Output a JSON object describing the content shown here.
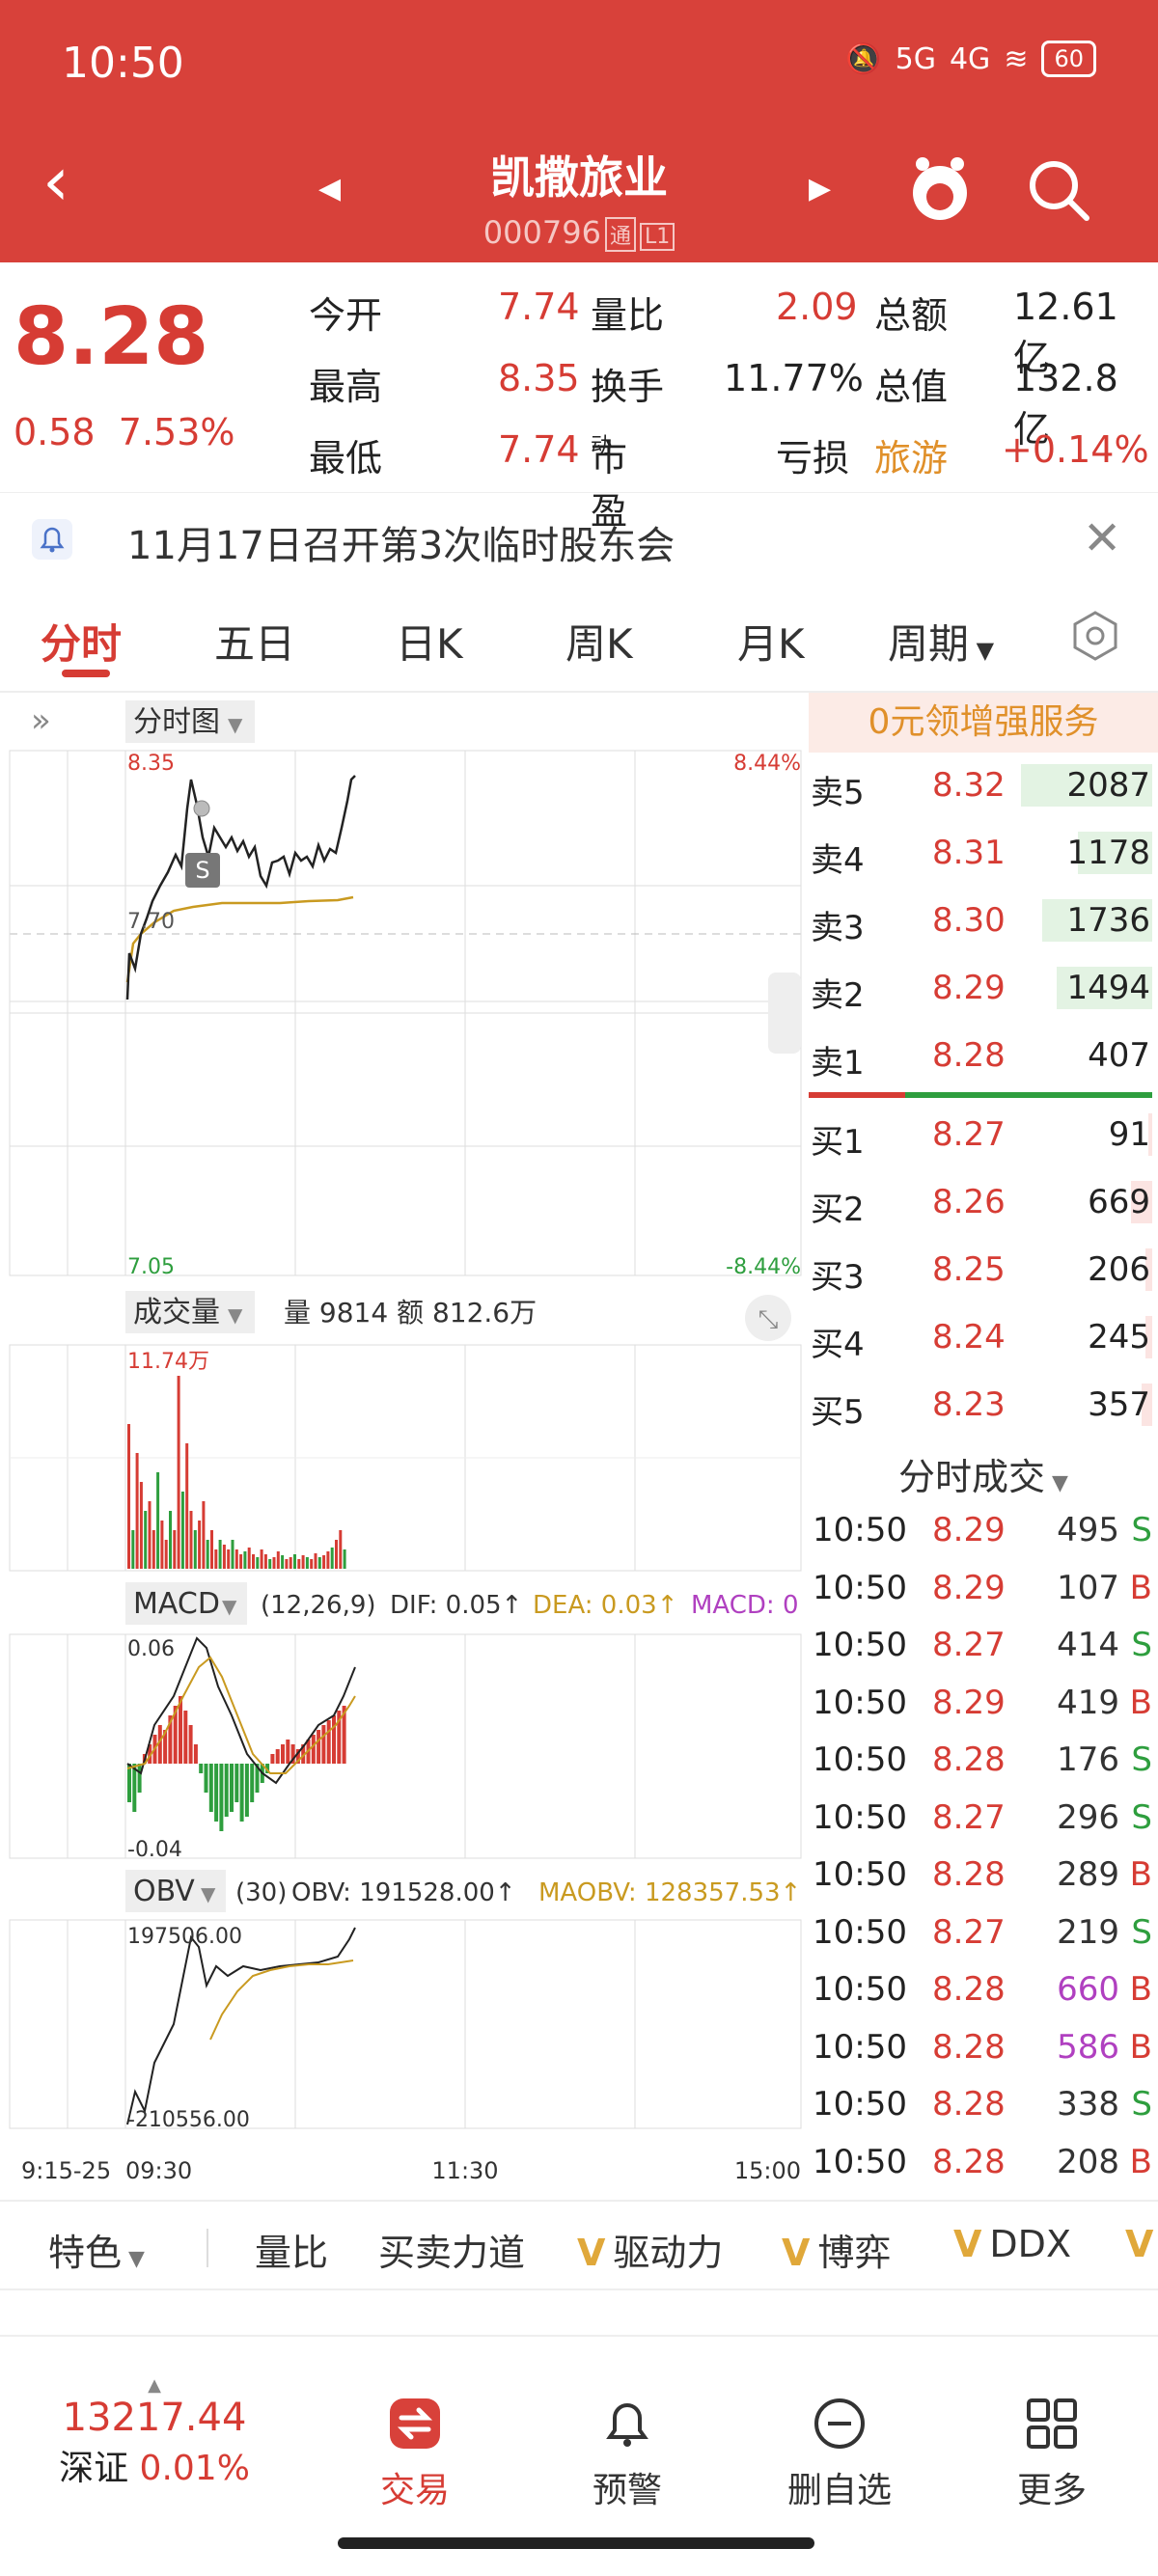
{
  "status": {
    "time": "10:50",
    "signal1": "5G",
    "signal2": "4G",
    "battery": "60"
  },
  "header": {
    "name": "凯撒旅业",
    "code": "000796",
    "tag1": "通",
    "tag2": "L1"
  },
  "quote": {
    "price": "8.28",
    "change_amt": "0.58",
    "change_pct": "7.53%",
    "rows": [
      {
        "l1": "今开",
        "v1": "7.74",
        "l2": "量比",
        "v2": "2.09",
        "l3": "总额",
        "v3": "12.61亿"
      },
      {
        "l1": "最高",
        "v1": "8.35",
        "l2": "换手",
        "v2": "11.77%",
        "l3": "总值",
        "v3": "132.8亿"
      },
      {
        "l1": "最低",
        "v1": "7.74",
        "l2": "市盈",
        "l2sup": "动",
        "v2": "亏损",
        "l3": "旅游",
        "v3": "+0.14%"
      }
    ]
  },
  "notice": {
    "text": "11月17日召开第3次临时股东会"
  },
  "tabs": [
    "分时",
    "五日",
    "日K",
    "周K",
    "月K",
    "周期"
  ],
  "chart": {
    "main_label": "分时图",
    "price_high": "8.35",
    "price_mid": "7.70",
    "price_low": "7.05",
    "pct_high": "8.44%",
    "pct_low": "-8.44%",
    "s_marker": "S",
    "volume_label": "成交量",
    "volume_info": "量 9814  额 812.6万",
    "volume_max": "11.74万",
    "macd_label": "MACD",
    "macd_params": "(12,26,9)",
    "macd_dif": "DIF: 0.05↑",
    "macd_dea": "DEA: 0.03↑",
    "macd_macd": "MACD: 0",
    "macd_high": "0.06",
    "macd_low": "-0.04",
    "obv_label": "OBV",
    "obv_params": "(30)",
    "obv_value": "OBV: 191528.00↑",
    "obv_ma": "MAOBV: 128357.53↑",
    "obv_high": "197506.00",
    "obv_low": "-210556.00",
    "time_pre": "9:15-25",
    "time_open": "09:30",
    "time_mid": "11:30",
    "time_close": "15:00"
  },
  "orderbook": {
    "title": "0元领增强服务",
    "sell": [
      {
        "label": "卖5",
        "price": "8.32",
        "vol": "2087",
        "frac": 0.62
      },
      {
        "label": "卖4",
        "price": "8.31",
        "vol": "1178",
        "frac": 0.35
      },
      {
        "label": "卖3",
        "price": "8.30",
        "vol": "1736",
        "frac": 0.52
      },
      {
        "label": "卖2",
        "price": "8.29",
        "vol": "1494",
        "frac": 0.45
      },
      {
        "label": "卖1",
        "price": "8.28",
        "vol": "407",
        "frac": 0.0
      }
    ],
    "buy": [
      {
        "label": "买1",
        "price": "8.27",
        "vol": "91",
        "frac": 0.02
      },
      {
        "label": "买2",
        "price": "8.26",
        "vol": "669",
        "frac": 0.1
      },
      {
        "label": "买3",
        "price": "8.25",
        "vol": "206",
        "frac": 0.03
      },
      {
        "label": "买4",
        "price": "8.24",
        "vol": "245",
        "frac": 0.03
      },
      {
        "label": "买5",
        "price": "8.23",
        "vol": "357",
        "frac": 0.05
      }
    ],
    "ticks_title": "分时成交",
    "ticks": [
      {
        "t": "10:50",
        "p": "8.29",
        "v": "495",
        "s": "S"
      },
      {
        "t": "10:50",
        "p": "8.29",
        "v": "107",
        "s": "B"
      },
      {
        "t": "10:50",
        "p": "8.27",
        "v": "414",
        "s": "S"
      },
      {
        "t": "10:50",
        "p": "8.29",
        "v": "419",
        "s": "B"
      },
      {
        "t": "10:50",
        "p": "8.28",
        "v": "176",
        "s": "S"
      },
      {
        "t": "10:50",
        "p": "8.27",
        "v": "296",
        "s": "S"
      },
      {
        "t": "10:50",
        "p": "8.28",
        "v": "289",
        "s": "B"
      },
      {
        "t": "10:50",
        "p": "8.27",
        "v": "219",
        "s": "S"
      },
      {
        "t": "10:50",
        "p": "8.28",
        "v": "660",
        "s": "B",
        "hl": true
      },
      {
        "t": "10:50",
        "p": "8.28",
        "v": "586",
        "s": "B",
        "hl": true
      },
      {
        "t": "10:50",
        "p": "8.28",
        "v": "338",
        "s": "S"
      },
      {
        "t": "10:50",
        "p": "8.28",
        "v": "208",
        "s": "B"
      }
    ]
  },
  "indicators": [
    "特色",
    "量比",
    "买卖力道",
    "驱动力",
    "博弈",
    "DDX"
  ],
  "nav": {
    "index_value": "13217.44",
    "index_name": "深证",
    "index_pct": "0.01%",
    "trade": "交易",
    "alert": "预警",
    "remove": "删自选",
    "more": "更多"
  },
  "colors": {
    "header": "#d8413a",
    "up": "#d63c34",
    "down": "#2e9e3e",
    "accent": "#e0902a"
  }
}
